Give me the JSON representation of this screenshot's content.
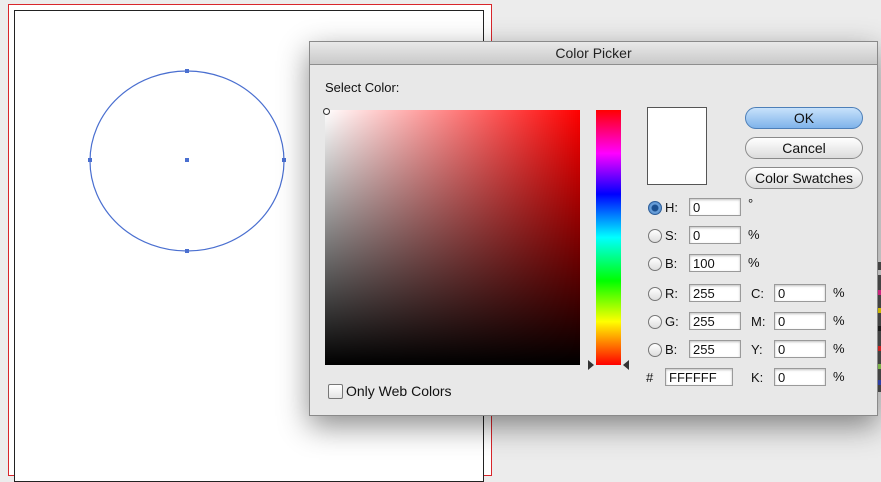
{
  "dialog": {
    "title": "Color Picker",
    "select_color_label": "Select Color:",
    "only_web_colors_label": "Only Web Colors",
    "buttons": {
      "ok": "OK",
      "cancel": "Cancel",
      "swatches": "Color Swatches"
    },
    "hsb": [
      {
        "label": "H:",
        "value": "0",
        "unit": "°",
        "selected": true
      },
      {
        "label": "S:",
        "value": "0",
        "unit": "%",
        "selected": false
      },
      {
        "label": "B:",
        "value": "100",
        "unit": "%",
        "selected": false
      }
    ],
    "rgb": [
      {
        "label": "R:",
        "value": "255"
      },
      {
        "label": "G:",
        "value": "255"
      },
      {
        "label": "B:",
        "value": "255"
      }
    ],
    "cmyk": [
      {
        "label": "C:",
        "value": "0",
        "unit": "%"
      },
      {
        "label": "M:",
        "value": "0",
        "unit": "%"
      },
      {
        "label": "Y:",
        "value": "0",
        "unit": "%"
      },
      {
        "label": "K:",
        "value": "0",
        "unit": "%"
      }
    ],
    "hex_label": "#",
    "hex_value": "FFFFFF",
    "current_color": "#FFFFFF"
  },
  "colors": {
    "ok_button_accent": "#7FB3EA",
    "ellipse_stroke": "#4A6FD0",
    "bleed_guide": "#D9262B"
  }
}
